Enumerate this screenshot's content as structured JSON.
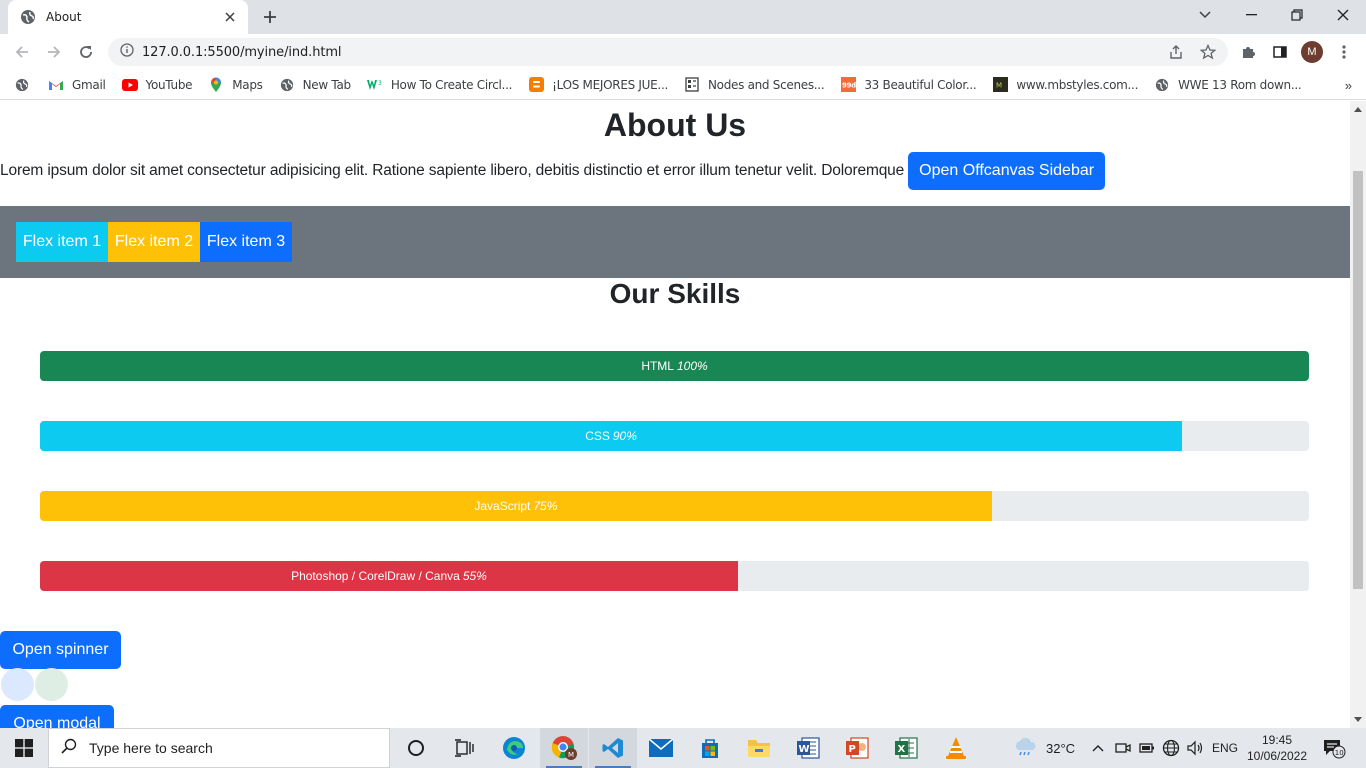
{
  "browser": {
    "tab_title": "About",
    "url": "127.0.0.1:5500/myine/ind.html",
    "profile_initial": "M"
  },
  "bookmarks": [
    {
      "label": "Gmail",
      "icon": "gmail-icon"
    },
    {
      "label": "YouTube",
      "icon": "youtube-icon"
    },
    {
      "label": "Maps",
      "icon": "maps-icon"
    },
    {
      "label": "New Tab",
      "icon": "globe-icon"
    },
    {
      "label": "How To Create Circl...",
      "icon": "w3-icon"
    },
    {
      "label": "¡LOS MEJORES JUE...",
      "icon": "blogger-icon"
    },
    {
      "label": "Nodes and Scenes...",
      "icon": "doc-icon"
    },
    {
      "label": "33 Beautiful Color...",
      "icon": "99d-icon"
    },
    {
      "label": "www.mbstyles.com...",
      "icon": "mb-icon"
    },
    {
      "label": "WWE 13 Rom down...",
      "icon": "globe-icon"
    }
  ],
  "page": {
    "title": "About Us",
    "lorem": "Lorem ipsum dolor sit amet consectetur adipisicing elit. Ratione sapiente libero, debitis distinctio et error illum tenetur velit. Doloremque",
    "offcanvas_button": "Open Offcanvas Sidebar",
    "flex_items": [
      {
        "label": "Flex item 1",
        "color": "#0dcaf0"
      },
      {
        "label": "Flex item 2",
        "color": "#ffc107"
      },
      {
        "label": "Flex item 3",
        "color": "#0d6efd"
      }
    ],
    "skills_title": "Our Skills",
    "skills": [
      {
        "name": "HTML",
        "percent_label": "100%",
        "value": 100,
        "color": "#198754"
      },
      {
        "name": "CSS",
        "percent_label": "90%",
        "value": 90,
        "color": "#0dcaf0"
      },
      {
        "name": "JavaScript",
        "percent_label": "75%",
        "value": 75,
        "color": "#ffc107"
      },
      {
        "name": "Photoshop / CorelDraw / Canva",
        "percent_label": "55%",
        "value": 55,
        "color": "#dc3545"
      }
    ],
    "spinner_button": "Open spinner",
    "modal_button": "Open modal",
    "grow_dots": [
      "#dbe8fe",
      "#dfeee5"
    ]
  },
  "taskbar": {
    "search_placeholder": "Type here to search",
    "weather": "32°C",
    "language": "ENG",
    "time": "19:45",
    "date": "10/06/2022",
    "notification_count": "10"
  }
}
